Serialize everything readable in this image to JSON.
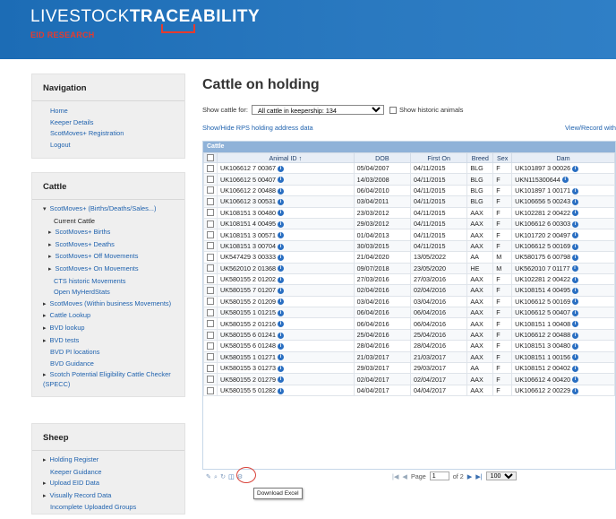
{
  "header": {
    "brand_light": "LIVESTOCK",
    "brand_bold": "TRACEABILITY",
    "subtitle": "EID RESEARCH",
    "bg_color": "#1f6fb4",
    "accent_color": "#e53b2e"
  },
  "nav_panel": {
    "title": "Navigation",
    "items": [
      "Home",
      "Keeper Details",
      "ScotMoves+ Registration",
      "Logout"
    ]
  },
  "cattle_panel": {
    "title": "Cattle",
    "items": [
      "ScotMoves+ (Births/Deaths/Sales...)",
      "Current Cattle",
      "ScotMoves+ Births",
      "ScotMoves+ Deaths",
      "ScotMoves+ Off Movements",
      "ScotMoves+ On Movements",
      "CTS historic Movements",
      "Open MyHerdStats",
      "ScotMoves (Within business Movements)",
      "Cattle Lookup",
      "BVD lookup",
      "BVD tests",
      "BVD PI locations",
      "BVD Guidance",
      "Scotch Potential Eligibility Cattle Checker (SPECC)"
    ]
  },
  "sheep_panel": {
    "title": "Sheep",
    "items": [
      "Holding Register",
      "Keeper Guidance",
      "Upload EID Data",
      "Visually Record Data",
      "Incomplete Uploaded Groups"
    ]
  },
  "main": {
    "title": "Cattle on holding",
    "filter_label": "Show cattle for:",
    "filter_value": "All cattle in keepership: 134",
    "historic_label": "Show historic animals",
    "rps_link": "Show/Hide RPS holding address data",
    "view_link": "View/Record with"
  },
  "grid": {
    "caption": "Cattle",
    "columns": [
      "Animal ID ↑",
      "DOB",
      "First On",
      "Breed",
      "Sex",
      "Dam"
    ],
    "rows": [
      [
        "UK106612 7 00367",
        "05/04/2007",
        "04/11/2015",
        "BLG",
        "F",
        "UK101897 3 00026"
      ],
      [
        "UK106612 5 00407",
        "14/03/2008",
        "04/11/2015",
        "BLG",
        "F",
        "UKN115300644"
      ],
      [
        "UK106612 2 00488",
        "06/04/2010",
        "04/11/2015",
        "BLG",
        "F",
        "UK101897 1 00171"
      ],
      [
        "UK106612 3 00531",
        "03/04/2011",
        "04/11/2015",
        "BLG",
        "F",
        "UK106656 5 00243"
      ],
      [
        "UK108151 3 00480",
        "23/03/2012",
        "04/11/2015",
        "AAX",
        "F",
        "UK102281 2 00422"
      ],
      [
        "UK108151 4 00495",
        "29/03/2012",
        "04/11/2015",
        "AAX",
        "F",
        "UK106612 6 00303"
      ],
      [
        "UK108151 3 00571",
        "01/04/2013",
        "04/11/2015",
        "AAX",
        "F",
        "UK101720 2 00497"
      ],
      [
        "UK108151 3 00704",
        "30/03/2015",
        "04/11/2015",
        "AAX",
        "F",
        "UK106612 5 00169"
      ],
      [
        "UK547429 3 00333",
        "21/04/2020",
        "13/05/2022",
        "AA",
        "M",
        "UK580175 6 00798"
      ],
      [
        "UK562010 2 01368",
        "09/07/2018",
        "23/05/2020",
        "HE",
        "M",
        "UK562010 7 01177"
      ],
      [
        "UK580155 2 01202",
        "27/03/2016",
        "27/03/2016",
        "AAX",
        "F",
        "UK102281 2 00422"
      ],
      [
        "UK580155 7 01207",
        "02/04/2016",
        "02/04/2016",
        "AAX",
        "F",
        "UK108151 4 00495"
      ],
      [
        "UK580155 2 01209",
        "03/04/2016",
        "03/04/2016",
        "AAX",
        "F",
        "UK106612 5 00169"
      ],
      [
        "UK580155 1 01215",
        "06/04/2016",
        "06/04/2016",
        "AAX",
        "F",
        "UK106612 5 00407"
      ],
      [
        "UK580155 2 01216",
        "06/04/2016",
        "06/04/2016",
        "AAX",
        "F",
        "UK108151 1 00408"
      ],
      [
        "UK580155 6 01241",
        "25/04/2016",
        "25/04/2016",
        "AAX",
        "F",
        "UK106612 2 00488"
      ],
      [
        "UK580155 6 01248",
        "28/04/2016",
        "28/04/2016",
        "AAX",
        "F",
        "UK108151 3 00480"
      ],
      [
        "UK580155 1 01271",
        "21/03/2017",
        "21/03/2017",
        "AAX",
        "F",
        "UK108151 1 00156"
      ],
      [
        "UK580155 3 01273",
        "29/03/2017",
        "29/03/2017",
        "AA",
        "F",
        "UK108151 2 00402"
      ],
      [
        "UK580155 2 01279",
        "02/04/2017",
        "02/04/2017",
        "AAX",
        "F",
        "UK106612 4 00420"
      ],
      [
        "UK580155 5 01282",
        "04/04/2017",
        "04/04/2017",
        "AAX",
        "F",
        "UK106612 2 00229"
      ]
    ]
  },
  "pager": {
    "page_label": "Page",
    "page_value": "1",
    "of_label": "of 2",
    "page_size": "100"
  },
  "tooltip": "Download Excel"
}
